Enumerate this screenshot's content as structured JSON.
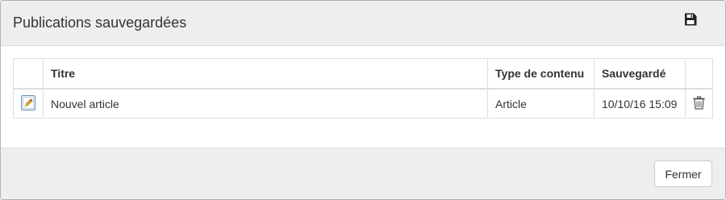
{
  "modal": {
    "title": "Publications sauvegardées",
    "header_icon": "save-icon"
  },
  "table": {
    "columns": [
      "",
      "Titre",
      "Type de contenu",
      "Sauvegardé",
      ""
    ],
    "rows": [
      {
        "edit_icon": "edit-pencil-icon",
        "title": "Nouvel article",
        "content_type": "Article",
        "saved": "10/10/16 15:09",
        "delete_icon": "trash-icon"
      }
    ]
  },
  "footer": {
    "close_label": "Fermer"
  }
}
